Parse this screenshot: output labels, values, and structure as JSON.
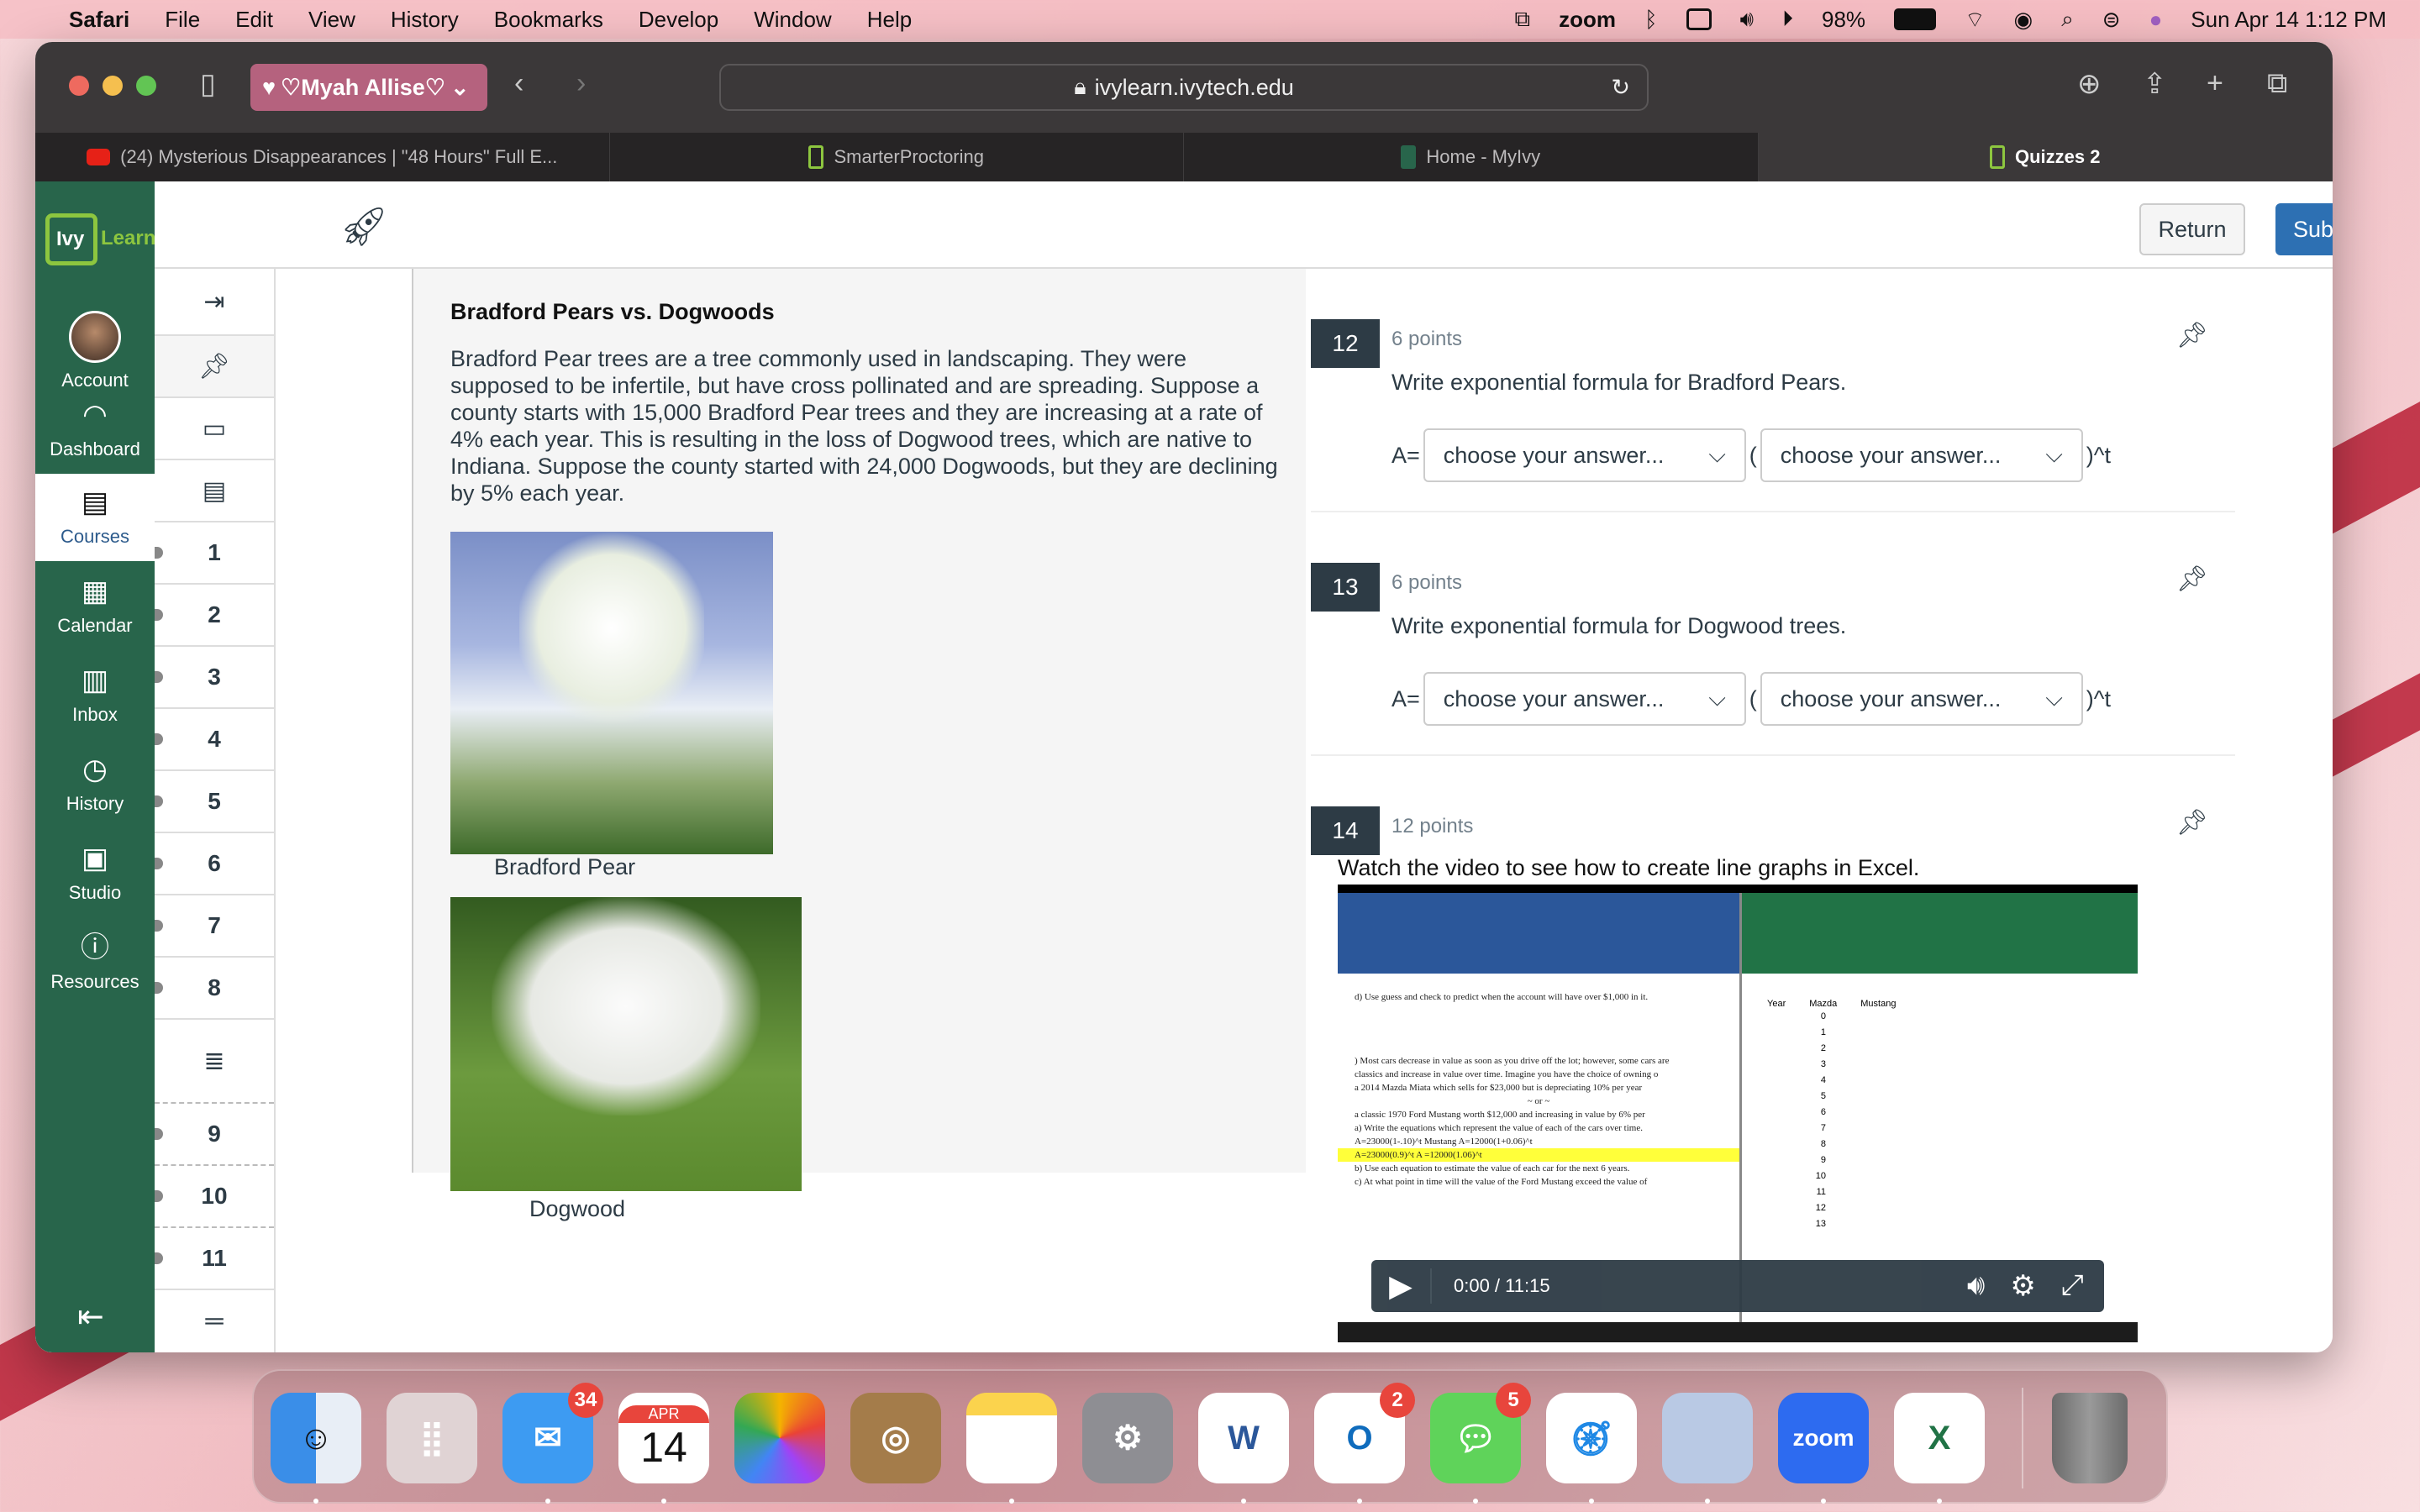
{
  "menubar": {
    "app": "Safari",
    "items": [
      "File",
      "Edit",
      "View",
      "History",
      "Bookmarks",
      "Develop",
      "Window",
      "Help"
    ],
    "status": {
      "zoom": "zoom",
      "battery": "98%",
      "datetime": "Sun Apr 14  1:12 PM"
    }
  },
  "browser": {
    "profile": "♡Myah Allise♡",
    "url": "ivylearn.ivytech.edu",
    "tabs": [
      {
        "label": "(24) Mysterious Disappearances | \"48 Hours\" Full E...",
        "active": false
      },
      {
        "label": "SmarterProctoring",
        "active": false
      },
      {
        "label": "Home - MyIvy",
        "active": false
      },
      {
        "label": "Quizzes 2",
        "active": true
      }
    ]
  },
  "global_nav": {
    "logo": {
      "part1": "Ivy",
      "part2": "Learn"
    },
    "items": [
      {
        "label": "Account",
        "icon": "avatar"
      },
      {
        "label": "Dashboard",
        "icon": "dashboard-icon"
      },
      {
        "label": "Courses",
        "icon": "courses-icon",
        "active": true
      },
      {
        "label": "Calendar",
        "icon": "calendar-icon"
      },
      {
        "label": "Inbox",
        "icon": "inbox-icon"
      },
      {
        "label": "History",
        "icon": "history-icon"
      },
      {
        "label": "Studio",
        "icon": "studio-icon"
      },
      {
        "label": "Resources",
        "icon": "help-icon"
      }
    ]
  },
  "header": {
    "return_label": "Return",
    "submit_label": "Submit"
  },
  "question_nav": [
    "1",
    "2",
    "3",
    "4",
    "5",
    "6",
    "7",
    "8",
    "9",
    "10",
    "11"
  ],
  "passage": {
    "title": "Bradford Pears vs. Dogwoods",
    "text": "Bradford Pear trees are a tree commonly used in landscaping. They were supposed to be infertile, but have cross pollinated and are spreading. Suppose a county starts with 15,000 Bradford Pear trees and they are increasing at a rate of 4% each year. This is resulting in the loss of Dogwood trees, which are native to Indiana. Suppose the county started with 24,000 Dogwoods, but they are declining by 5% each year.",
    "captions": {
      "pear": "Bradford Pear",
      "dogwood": "Dogwood"
    }
  },
  "questions": [
    {
      "number": "12",
      "points": "6 points",
      "text": "Write exponential formula for Bradford Pears.",
      "prefix": "A=",
      "open": "(",
      "suffix": ")^t",
      "select1": "choose your answer...",
      "select2": "choose your answer..."
    },
    {
      "number": "13",
      "points": "6 points",
      "text": "Write exponential formula for Dogwood trees.",
      "prefix": "A=",
      "open": "(",
      "suffix": ")^t",
      "select1": "choose your answer...",
      "select2": "choose your answer..."
    },
    {
      "number": "14",
      "points": "12 points",
      "text": "Watch the video to see how to create line graphs in Excel."
    }
  ],
  "video": {
    "time": "0:00 / 11:15",
    "word_lines": [
      "d) Use guess and check to predict when the account will have over $1,000 in it.",
      ") Most cars decrease in value as soon as you drive off the lot; however, some cars are",
      "classics and increase in value over time. Imagine you have the choice of owning o",
      "a 2014 Mazda Miata which sells for $23,000 but is depreciating 10% per year",
      "~ or ~",
      "a classic 1970 Ford Mustang worth $12,000 and increasing in value by 6% per",
      "a) Write the equations which represent the value of each of the cars over time.",
      "A=23000(1-.10)^t          Mustang  A=12000(1+0.06)^t",
      "A=23000(0.9)^t                          A =12000(1.06)^t",
      "b) Use each equation to estimate the value of each car for the next 6 years.",
      "c) At what point in time will the value of the Ford Mustang exceed the value of"
    ],
    "excel_headers": [
      "Year",
      "Mazda",
      "Mustang"
    ],
    "excel_years": [
      "0",
      "1",
      "2",
      "3",
      "4",
      "5",
      "6",
      "7",
      "8",
      "9",
      "10",
      "11",
      "12",
      "13"
    ]
  },
  "dock": [
    {
      "name": "Finder"
    },
    {
      "name": "Launchpad"
    },
    {
      "name": "Mail",
      "badge": "34"
    },
    {
      "name": "Calendar",
      "month": "APR",
      "day": "14"
    },
    {
      "name": "Photos"
    },
    {
      "name": "Contacts"
    },
    {
      "name": "Notes"
    },
    {
      "name": "System Settings"
    },
    {
      "name": "Word",
      "glyph": "W"
    },
    {
      "name": "Outlook",
      "glyph": "O",
      "badge": "2"
    },
    {
      "name": "Messages",
      "badge": "5"
    },
    {
      "name": "Safari"
    },
    {
      "name": "Preview"
    },
    {
      "name": "Zoom",
      "glyph": "zoom"
    },
    {
      "name": "Excel",
      "glyph": "X"
    },
    {
      "name": "Trash"
    }
  ]
}
